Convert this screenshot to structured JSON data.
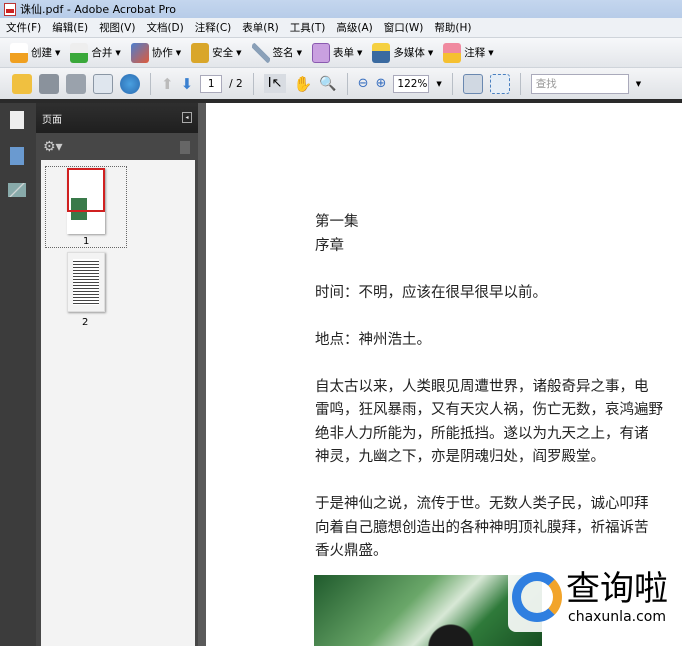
{
  "window": {
    "title": "诛仙.pdf - Adobe Acrobat Pro"
  },
  "menu": [
    "文件(F)",
    "编辑(E)",
    "视图(V)",
    "文档(D)",
    "注释(C)",
    "表单(R)",
    "工具(T)",
    "高级(A)",
    "窗口(W)",
    "帮助(H)"
  ],
  "tasks": [
    "创建",
    "合并",
    "协作",
    "安全",
    "签名",
    "表单",
    "多媒体",
    "注释"
  ],
  "nav": {
    "page": "1",
    "total": "/ 2",
    "zoom": "122%",
    "find_placeholder": "查找"
  },
  "sidebar": {
    "title": "页面",
    "thumbs": [
      "1",
      "2"
    ]
  },
  "doc": {
    "lines": [
      "第一集",
      "序章",
      "",
      "时间：不明，应该在很早很早以前。",
      "",
      "地点：神州浩土。",
      "",
      "自太古以来，人类眼见周遭世界，诸般奇异之事，电",
      "雷鸣，狂风暴雨，又有天灾人祸，伤亡无数，哀鸿遍野",
      "绝非人力所能为，所能抵挡。遂以为九天之上，有诸",
      "神灵，九幽之下，亦是阴魂归处，阎罗殿堂。",
      "",
      "于是神仙之说，流传于世。无数人类子民，诚心叩拜",
      "向着自己臆想创造出的各种神明顶礼膜拜，祈福诉苦",
      "香火鼎盛。"
    ]
  },
  "watermark": {
    "name": "查询啦",
    "url": "chaxunla.com"
  }
}
